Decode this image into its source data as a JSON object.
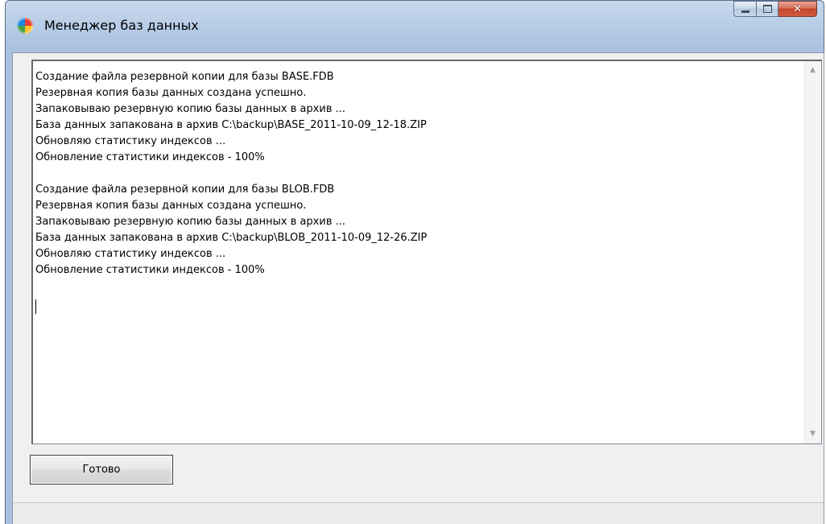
{
  "window": {
    "title": "Менеджер баз данных"
  },
  "log": {
    "lines": [
      "Создание файла резервной копии для базы BASE.FDB",
      "Резервная копия базы данных создана успешно.",
      "Запаковываю резервную копию базы данных в архив ...",
      "База данных запакована в архив C:\\backup\\BASE_2011-10-09_12-18.ZIP",
      "Обновляю статистику индексов ...",
      "Обновление статистики индексов - 100%",
      "",
      "Создание файла резервной копии для базы BLOB.FDB",
      "Резервная копия базы данных создана успешно.",
      "Запаковываю резервную копию базы данных в архив ...",
      "База данных запакована в архив C:\\backup\\BLOB_2011-10-09_12-26.ZIP",
      "Обновляю статистику индексов ...",
      "Обновление статистики индексов - 100%"
    ]
  },
  "buttons": {
    "done_label": "Готово"
  },
  "icons": {
    "app": "database-manager-icon",
    "minimize": "minimize-icon",
    "maximize": "maximize-icon",
    "close": "close-icon",
    "scroll_up": "scroll-up-arrow-icon",
    "scroll_down": "scroll-down-arrow-icon"
  },
  "colors": {
    "titlebar": "#b9cde6",
    "close_button": "#c4452b",
    "client_background": "#f0f0f0"
  }
}
